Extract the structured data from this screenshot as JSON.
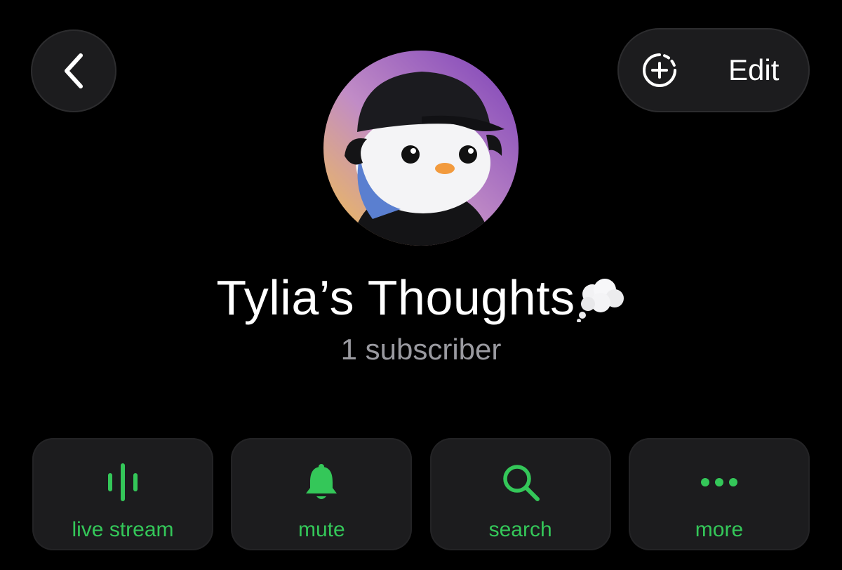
{
  "header": {
    "back_icon": "chevron-left-icon",
    "add_story_icon": "add-story-icon",
    "edit_label": "Edit"
  },
  "profile": {
    "avatar": "penguin-avatar",
    "title": "Tylia’s Thoughts",
    "title_emoji": "thought-balloon-icon",
    "subtitle": "1 subscriber"
  },
  "actions": [
    {
      "label": "live stream",
      "icon": "live-stream-icon"
    },
    {
      "label": "mute",
      "icon": "bell-icon"
    },
    {
      "label": "search",
      "icon": "search-icon"
    },
    {
      "label": "more",
      "icon": "more-icon"
    }
  ],
  "colors": {
    "accent": "#34c759",
    "background": "#000000",
    "button_bg": "#1c1c1e",
    "subtitle": "#9a9aa0"
  }
}
